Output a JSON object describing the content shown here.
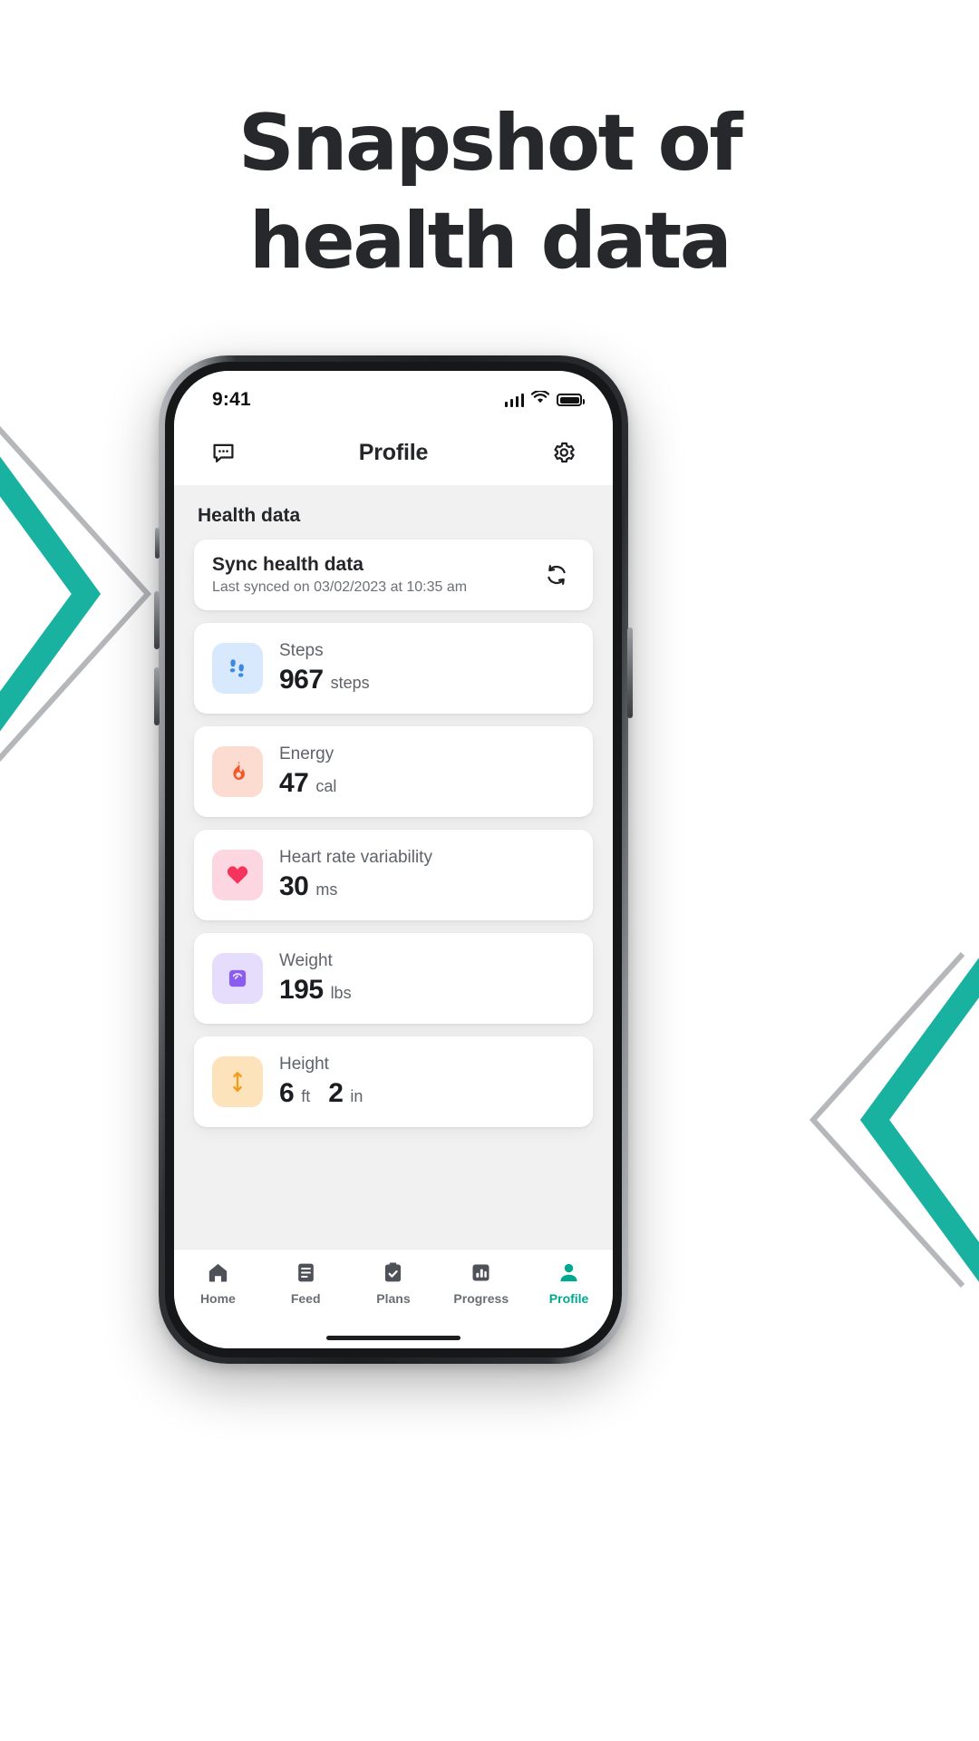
{
  "headline": {
    "line1": "Snapshot of",
    "line2": "health data"
  },
  "theme": {
    "accent": "#00a88f",
    "chevron_teal": "#19b2a0",
    "chevron_gray": "#b5b7ba",
    "text_dark": "#24262a",
    "text_muted": "#5f6369",
    "screen_bg": "#f1f1f2"
  },
  "phone": {
    "status": {
      "time": "9:41",
      "cellular_icon": "signal-bars-icon",
      "wifi_icon": "wifi-icon",
      "battery_icon": "battery-full-icon"
    },
    "appbar": {
      "left_icon": "chat-bubble-icon",
      "title": "Profile",
      "right_icon": "gear-icon"
    },
    "section": {
      "title": "Health data"
    },
    "sync": {
      "title": "Sync health data",
      "subtitle": "Last synced on 03/02/2023 at 10:35 am",
      "icon": "refresh-icon"
    },
    "metrics": [
      {
        "key": "steps",
        "icon": "footprints-icon",
        "label": "Steps",
        "value": "967",
        "unit": "steps",
        "tile_bg": "#d9e9fd",
        "icon_color": "#3b8ae2"
      },
      {
        "key": "energy",
        "icon": "flame-icon",
        "label": "Energy",
        "value": "47",
        "unit": "cal",
        "tile_bg": "#fcdbd0",
        "icon_color": "#f4582a"
      },
      {
        "key": "heart-rate-variability",
        "icon": "heart-icon",
        "label": "Heart rate variability",
        "value": "30",
        "unit": "ms",
        "tile_bg": "#fcd6e0",
        "icon_color": "#f5335c"
      },
      {
        "key": "weight",
        "icon": "scale-icon",
        "label": "Weight",
        "value": "195",
        "unit": "lbs",
        "tile_bg": "#e6dcfb",
        "icon_color": "#8b5cf0"
      },
      {
        "key": "height",
        "icon": "height-arrow-icon",
        "label": "Height",
        "value": "6",
        "unit": "ft",
        "value2": "2",
        "unit2": "in",
        "tile_bg": "#fce3bb",
        "icon_color": "#f59b1b"
      }
    ],
    "tabs": [
      {
        "key": "home",
        "label": "Home",
        "icon": "home-icon",
        "active": false
      },
      {
        "key": "feed",
        "label": "Feed",
        "icon": "list-icon",
        "active": false
      },
      {
        "key": "plans",
        "label": "Plans",
        "icon": "clipboard-icon",
        "active": false
      },
      {
        "key": "progress",
        "label": "Progress",
        "icon": "bar-chart-icon",
        "active": false
      },
      {
        "key": "profile",
        "label": "Profile",
        "icon": "person-icon",
        "active": true
      }
    ]
  }
}
